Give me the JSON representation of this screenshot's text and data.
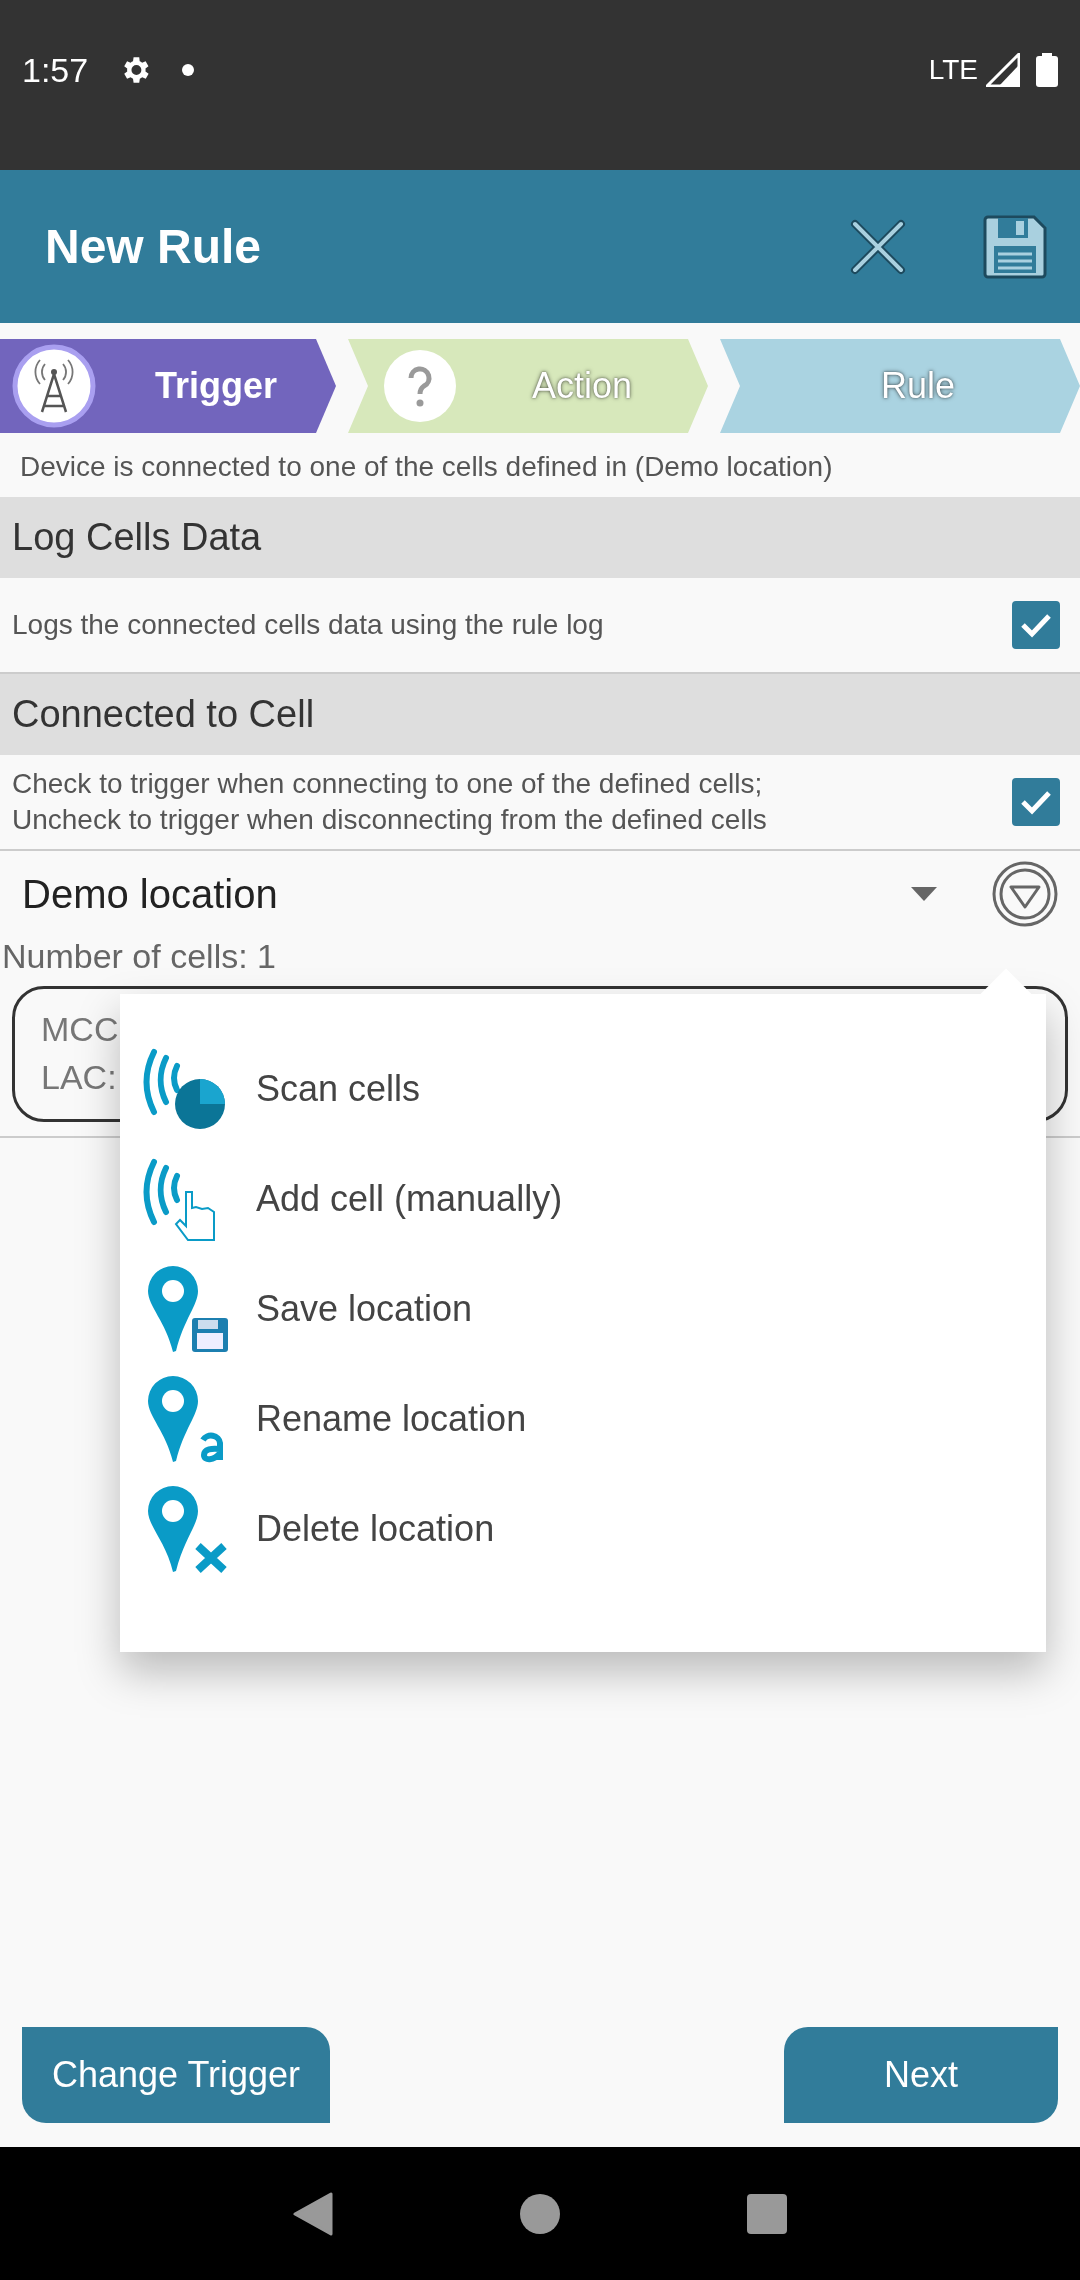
{
  "status_bar": {
    "time": "1:57",
    "network": "LTE"
  },
  "app_bar": {
    "title": "New Rule"
  },
  "steps": [
    {
      "label": "Trigger",
      "selected": true,
      "color": "#7265bd",
      "kind": "tower"
    },
    {
      "label": "Action",
      "selected": false,
      "color": "#d7e8bb",
      "kind": "question"
    },
    {
      "label": "Rule",
      "selected": false,
      "color": "#aad3e1",
      "kind": "none"
    }
  ],
  "description": "Device is connected to one of the cells defined in (Demo location)",
  "sections": [
    {
      "title": "Log Cells Data",
      "text": "Logs the connected cells data using the rule log",
      "checked": true
    },
    {
      "title": "Connected to Cell",
      "text": "Check to trigger when connecting to one of the defined cells;\nUncheck to trigger when disconnecting from the defined cells",
      "checked": true
    }
  ],
  "location_dropdown": {
    "value": "Demo location"
  },
  "cell_count": "Number of cells: 1",
  "cell_card": {
    "lines": [
      "MCC",
      "LAC:"
    ]
  },
  "menu": [
    {
      "label": "Scan cells",
      "kind": "scan"
    },
    {
      "label": "Add cell (manually)",
      "kind": "add"
    },
    {
      "label": "Save location",
      "kind": "save"
    },
    {
      "label": "Rename location",
      "kind": "rename"
    },
    {
      "label": "Delete location",
      "kind": "delete"
    }
  ],
  "buttons": {
    "left": "Change Trigger",
    "right": "Next"
  }
}
